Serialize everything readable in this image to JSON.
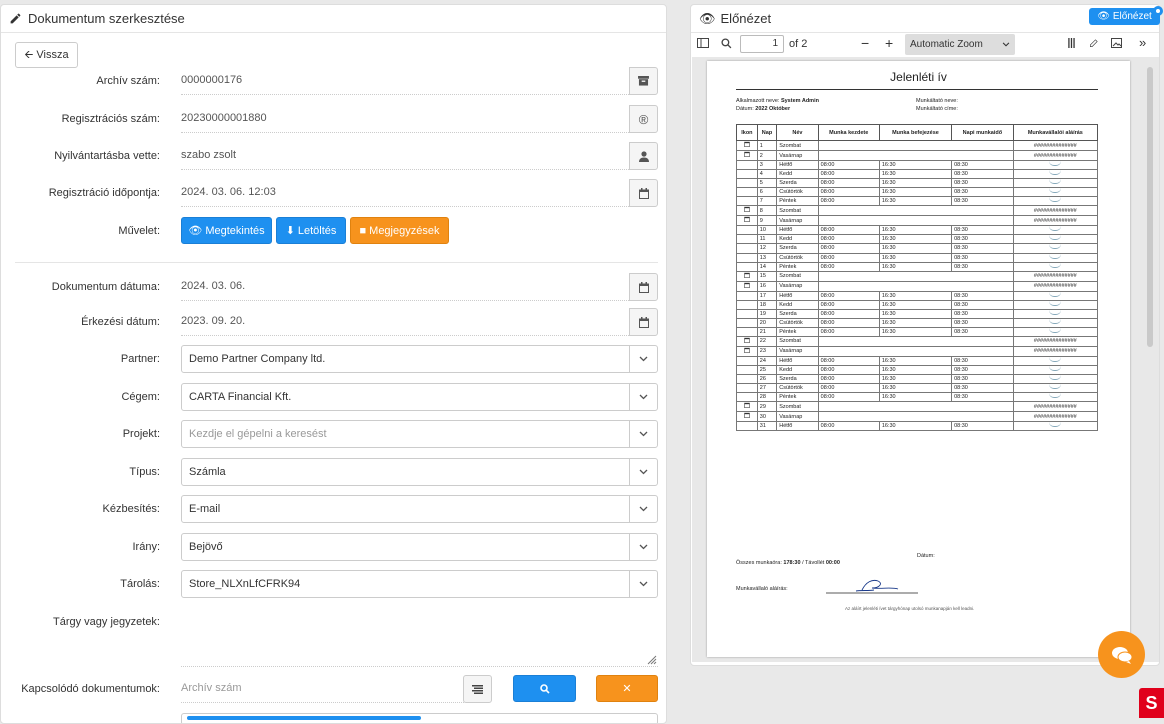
{
  "left_panel": {
    "title": "Dokumentum szerkesztése",
    "back_label": "Vissza",
    "fields": {
      "archive_label": "Archív szám:",
      "archive_value": "0000000176",
      "reg_label": "Regisztrációs szám:",
      "reg_value": "20230000001880",
      "registered_by_label": "Nyilvántartásba vette:",
      "registered_by_value": "szabo zsolt",
      "reg_time_label": "Regisztráció időpontja:",
      "reg_time_value": "2024. 03. 06. 12:03",
      "action_label": "Művelet:",
      "view_btn": "Megtekintés",
      "download_btn": "Letöltés",
      "notes_btn": "Megjegyzések",
      "doc_date_label": "Dokumentum dátuma:",
      "doc_date_value": "2024. 03. 06.",
      "arrival_label": "Érkezési dátum:",
      "arrival_value": "2023. 09. 20.",
      "partner_label": "Partner:",
      "partner_value": "Demo Partner Company ltd.",
      "company_label": "Cégem:",
      "company_value": "CARTA Financial Kft.",
      "project_label": "Projekt:",
      "project_placeholder": "Kezdje el gépelni a keresést",
      "type_label": "Típus:",
      "type_value": "Számla",
      "delivery_label": "Kézbesítés:",
      "delivery_value": "E-mail",
      "direction_label": "Irány:",
      "direction_value": "Bejövő",
      "storage_label": "Tárolás:",
      "storage_value": "Store_NLXnLfCFRK94",
      "subject_label": "Tárgy vagy jegyzetek:",
      "related_label": "Kapcsolódó dokumentumok:",
      "related_placeholder": "Archív szám"
    }
  },
  "right_panel": {
    "title": "Előnézet",
    "preview_btn": "Előnézet",
    "page_current": "1",
    "page_total": "of 2",
    "zoom": "Automatic Zoom"
  },
  "document": {
    "title": "Jelenléti ív",
    "employee_name_label": "Alkalmazott neve:",
    "employee_name": "System Admin",
    "employer_name_label": "Munkáltató neve:",
    "date_label": "Dátum:",
    "date_value": "2022 Október",
    "employer_addr_label": "Munkáltató címe:",
    "headers": [
      "Ikon",
      "Nap",
      "Név",
      "Munka kezdete",
      "Munka befejezése",
      "Napi munkaidő",
      "Munkavállalói aláírás"
    ],
    "rows": [
      {
        "day": "1",
        "name": "Szombat",
        "off": true
      },
      {
        "day": "2",
        "name": "Vasárnap",
        "off": true
      },
      {
        "day": "3",
        "name": "Hétfő",
        "start": "08:00",
        "end": "16:30",
        "hours": "08:30"
      },
      {
        "day": "4",
        "name": "Kedd",
        "start": "08:00",
        "end": "16:30",
        "hours": "08:30"
      },
      {
        "day": "5",
        "name": "Szerda",
        "start": "08:00",
        "end": "16:30",
        "hours": "08:30"
      },
      {
        "day": "6",
        "name": "Csütörtök",
        "start": "08:00",
        "end": "16:30",
        "hours": "08:30"
      },
      {
        "day": "7",
        "name": "Péntek",
        "start": "08:00",
        "end": "16:30",
        "hours": "08:30"
      },
      {
        "day": "8",
        "name": "Szombat",
        "off": true
      },
      {
        "day": "9",
        "name": "Vasárnap",
        "off": true
      },
      {
        "day": "10",
        "name": "Hétfő",
        "start": "08:00",
        "end": "16:30",
        "hours": "08:30"
      },
      {
        "day": "11",
        "name": "Kedd",
        "start": "08:00",
        "end": "16:30",
        "hours": "08:30"
      },
      {
        "day": "12",
        "name": "Szerda",
        "start": "08:00",
        "end": "16:30",
        "hours": "08:30"
      },
      {
        "day": "13",
        "name": "Csütörtök",
        "start": "08:00",
        "end": "16:30",
        "hours": "08:30"
      },
      {
        "day": "14",
        "name": "Péntek",
        "start": "08:00",
        "end": "16:30",
        "hours": "08:30"
      },
      {
        "day": "15",
        "name": "Szombat",
        "off": true
      },
      {
        "day": "16",
        "name": "Vasárnap",
        "off": true
      },
      {
        "day": "17",
        "name": "Hétfő",
        "start": "08:00",
        "end": "16:30",
        "hours": "08:30"
      },
      {
        "day": "18",
        "name": "Kedd",
        "start": "08:00",
        "end": "16:30",
        "hours": "08:30"
      },
      {
        "day": "19",
        "name": "Szerda",
        "start": "08:00",
        "end": "16:30",
        "hours": "08:30"
      },
      {
        "day": "20",
        "name": "Csütörtök",
        "start": "08:00",
        "end": "16:30",
        "hours": "08:30"
      },
      {
        "day": "21",
        "name": "Péntek",
        "start": "08:00",
        "end": "16:30",
        "hours": "08:30"
      },
      {
        "day": "22",
        "name": "Szombat",
        "off": true
      },
      {
        "day": "23",
        "name": "Vasárnap",
        "off": true
      },
      {
        "day": "24",
        "name": "Hétfő",
        "start": "08:00",
        "end": "16:30",
        "hours": "08:30"
      },
      {
        "day": "25",
        "name": "Kedd",
        "start": "08:00",
        "end": "16:30",
        "hours": "08:30"
      },
      {
        "day": "26",
        "name": "Szerda",
        "start": "08:00",
        "end": "16:30",
        "hours": "08:30"
      },
      {
        "day": "27",
        "name": "Csütörtök",
        "start": "08:00",
        "end": "16:30",
        "hours": "08:30"
      },
      {
        "day": "28",
        "name": "Péntek",
        "start": "08:00",
        "end": "16:30",
        "hours": "08:30"
      },
      {
        "day": "29",
        "name": "Szombat",
        "off": true
      },
      {
        "day": "30",
        "name": "Vasárnap",
        "off": true
      },
      {
        "day": "31",
        "name": "Hétfő",
        "start": "08:00",
        "end": "16:30",
        "hours": "08:30"
      }
    ],
    "off_mark": "##############",
    "total_label": "Összes munkaóra:",
    "total_value": "178:30",
    "absent_label": "/ Távollét",
    "absent_value": "00:00",
    "footer_date_label": "Dátum:",
    "sign_label": "Munkavállaló aláírás:",
    "note": "Az aláírt jelenléti ívet tárgyhónap utolsó munkanapján kell leadni."
  },
  "colors": {
    "primary": "#1e90f0",
    "accent": "#f7931d",
    "brand": "#e0001b"
  }
}
